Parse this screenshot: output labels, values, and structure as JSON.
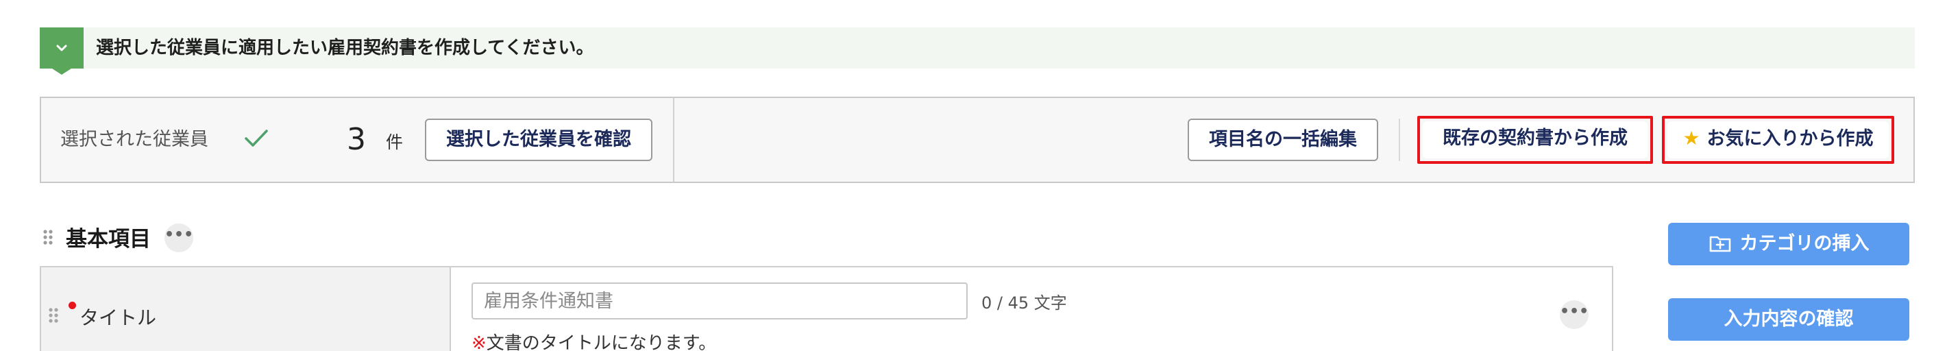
{
  "notice": {
    "text": "選択した従業員に適用したい雇用契約書を作成してください。",
    "icon": "chevron-down-icon",
    "color": "#5aa65a"
  },
  "selection": {
    "label": "選択された従業員",
    "count": "3",
    "unit": "件",
    "confirm_button": "選択した従業員を確認",
    "bulk_edit_button": "項目名の一括編集",
    "from_existing_button": "既存の契約書から作成",
    "from_favorites_button": "お気に入りから作成",
    "highlight_color": "#e8141b"
  },
  "section": {
    "title": "基本項目",
    "more": "•••"
  },
  "fields": {
    "title": {
      "label": "タイトル",
      "placeholder": "雇用条件通知書",
      "char_count": "0 / 45 文字",
      "hint_mark": "※",
      "hint": "文書のタイトルになります。",
      "more": "•••"
    }
  },
  "sidebar": {
    "insert_category": "カテゴリの挿入",
    "review_input": "入力内容の確認",
    "accent": "#5b9cf0"
  }
}
